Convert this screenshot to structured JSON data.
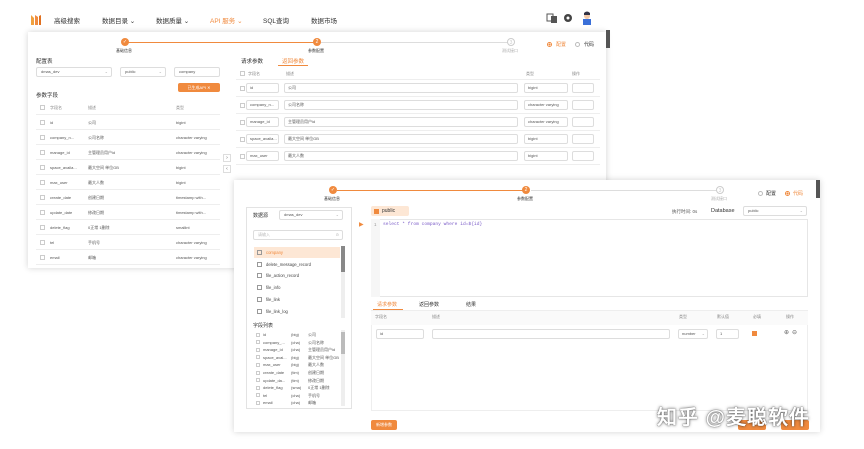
{
  "nav": {
    "items": [
      {
        "label": "高级搜索"
      },
      {
        "label": "数据目录 ⌄"
      },
      {
        "label": "数据质量 ⌄"
      },
      {
        "label": "API 服务 ⌄"
      },
      {
        "label": "SQL查询"
      },
      {
        "label": "数据市场"
      }
    ],
    "active_index": 3
  },
  "back": {
    "steps": [
      {
        "label": "基础信息",
        "glyph": "✓"
      },
      {
        "label": "参数配置",
        "glyph": "2"
      },
      {
        "label": "测试接口",
        "glyph": "3"
      }
    ],
    "mode": {
      "config_label": "配置",
      "code_label": "代码"
    },
    "config_table_title": "配置表",
    "datasource_value": "dmas_dev",
    "schema_value": "public",
    "table_value": "company",
    "generate_button": "已生成API ✕",
    "param_fields_title": "参数字段",
    "left_headers": {
      "name": "字段名",
      "desc": "描述",
      "type": "类型"
    },
    "left_rows": [
      {
        "name": "id",
        "desc": "公司",
        "type": "bigint"
      },
      {
        "name": "company_n...",
        "desc": "公司名称",
        "type": "character varying"
      },
      {
        "name": "manage_id",
        "desc": "主管理员用户id",
        "type": "character varying"
      },
      {
        "name": "space_availa...",
        "desc": "最大空间 单位GB",
        "type": "bigint"
      },
      {
        "name": "max_user",
        "desc": "最大人数",
        "type": "bigint"
      },
      {
        "name": "create_date",
        "desc": "创建日期",
        "type": "timestamp with..."
      },
      {
        "name": "update_date",
        "desc": "修改日期",
        "type": "timestamp with..."
      },
      {
        "name": "delete_flag",
        "desc": "0正常 1删除",
        "type": "smallint"
      },
      {
        "name": "tel",
        "desc": "手机号",
        "type": "character varying"
      },
      {
        "name": "email",
        "desc": "邮箱",
        "type": "character varying"
      }
    ],
    "tabs": [
      {
        "label": "请求参数"
      },
      {
        "label": "返回参数"
      }
    ],
    "right_headers": {
      "name": "字段名",
      "desc": "描述",
      "type": "类型",
      "ops": "操作"
    },
    "right_rows": [
      {
        "name": "id",
        "desc": "公司",
        "type": "bigint"
      },
      {
        "name": "company_n...",
        "desc": "公司名称",
        "type": "character varying"
      },
      {
        "name": "manage_id",
        "desc": "主管理员用户id",
        "type": "character varying"
      },
      {
        "name": "space_availa...",
        "desc": "最大空间 单位GB",
        "type": "bigint"
      },
      {
        "name": "max_user",
        "desc": "最大人数",
        "type": "bigint"
      }
    ]
  },
  "front": {
    "steps": [
      {
        "label": "基础信息",
        "glyph": "✓"
      },
      {
        "label": "参数配置",
        "glyph": "2"
      },
      {
        "label": "测试接口",
        "glyph": "3"
      }
    ],
    "mode": {
      "config_label": "配置",
      "code_label": "代码"
    },
    "datasource_label": "数据源",
    "datasource_value": "dmas_dev",
    "search_placeholder": "请输入",
    "tables": [
      {
        "label": "company"
      },
      {
        "label": "delete_message_record"
      },
      {
        "label": "file_action_record"
      },
      {
        "label": "file_info"
      },
      {
        "label": "file_link"
      },
      {
        "label": "file_link_log"
      }
    ],
    "field_list_title": "字段列表",
    "fields": [
      {
        "name": "id",
        "type": "(big)",
        "desc": "公司"
      },
      {
        "name": "company_...",
        "type": "(cha)",
        "desc": "公司名称"
      },
      {
        "name": "manage_id",
        "type": "(cha)",
        "desc": "主管理员用户id"
      },
      {
        "name": "space_avai...",
        "type": "(big)",
        "desc": "最大空间 单位GB"
      },
      {
        "name": "max_user",
        "type": "(big)",
        "desc": "最大人数"
      },
      {
        "name": "create_date",
        "type": "(tim)",
        "desc": "创建日期"
      },
      {
        "name": "update_da...",
        "type": "(tim)",
        "desc": "修改日期"
      },
      {
        "name": "delete_flag",
        "type": "(sma)",
        "desc": "0正常 1删除"
      },
      {
        "name": "tel",
        "type": "(cha)",
        "desc": "手机号"
      },
      {
        "name": "email",
        "type": "(cha)",
        "desc": "邮箱"
      }
    ],
    "schema_tag": "public",
    "exec_time_label": "执行时间: 0s",
    "database_label": "Database",
    "database_value": "public",
    "line_number": "1",
    "sql": "select * from company where id=${id}",
    "tabs": [
      {
        "label": "请求参数"
      },
      {
        "label": "返回参数"
      },
      {
        "label": "结果"
      }
    ],
    "param_headers": {
      "name": "字段名",
      "desc": "描述",
      "type": "类型",
      "default": "默认值",
      "required": "必填",
      "ops": "操作"
    },
    "param_row": {
      "name": "id",
      "desc": "",
      "type": "number",
      "default": "1"
    },
    "add_button": "新增参数"
  },
  "watermark": "知乎 @麦聪软件",
  "colors": {
    "accent": "#f08a3e"
  }
}
